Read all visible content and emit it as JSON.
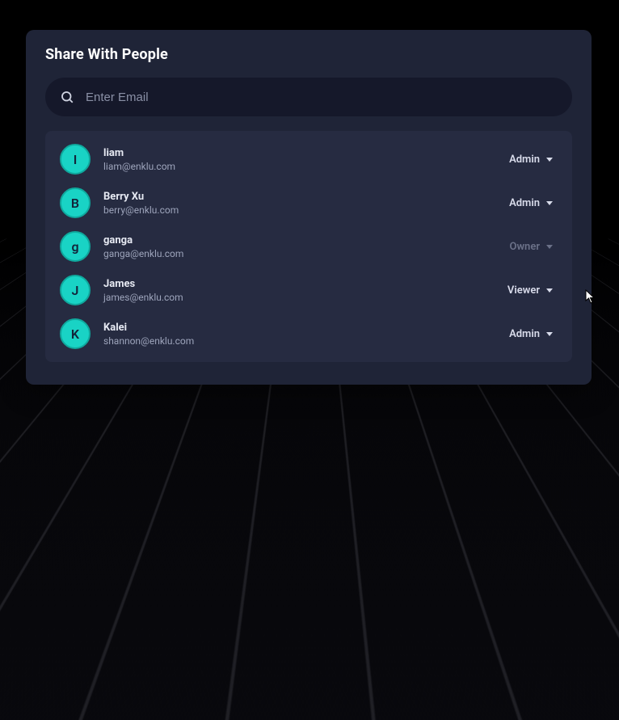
{
  "modal": {
    "title": "Share With People",
    "search": {
      "placeholder": "Enter Email",
      "value": ""
    },
    "people": [
      {
        "initial": "I",
        "name": "liam",
        "email": "liam@enklu.com",
        "role": "Admin",
        "editable": true
      },
      {
        "initial": "B",
        "name": "Berry Xu",
        "email": "berry@enklu.com",
        "role": "Admin",
        "editable": true
      },
      {
        "initial": "g",
        "name": "ganga",
        "email": "ganga@enklu.com",
        "role": "Owner",
        "editable": false
      },
      {
        "initial": "J",
        "name": "James",
        "email": "james@enklu.com",
        "role": "Viewer",
        "editable": true
      },
      {
        "initial": "K",
        "name": "Kalei",
        "email": "shannon@enklu.com",
        "role": "Admin",
        "editable": true
      }
    ]
  },
  "colors": {
    "avatar": "#19d3c5",
    "panel": "#1f2437",
    "list": "#262b41",
    "search": "#15182a"
  }
}
